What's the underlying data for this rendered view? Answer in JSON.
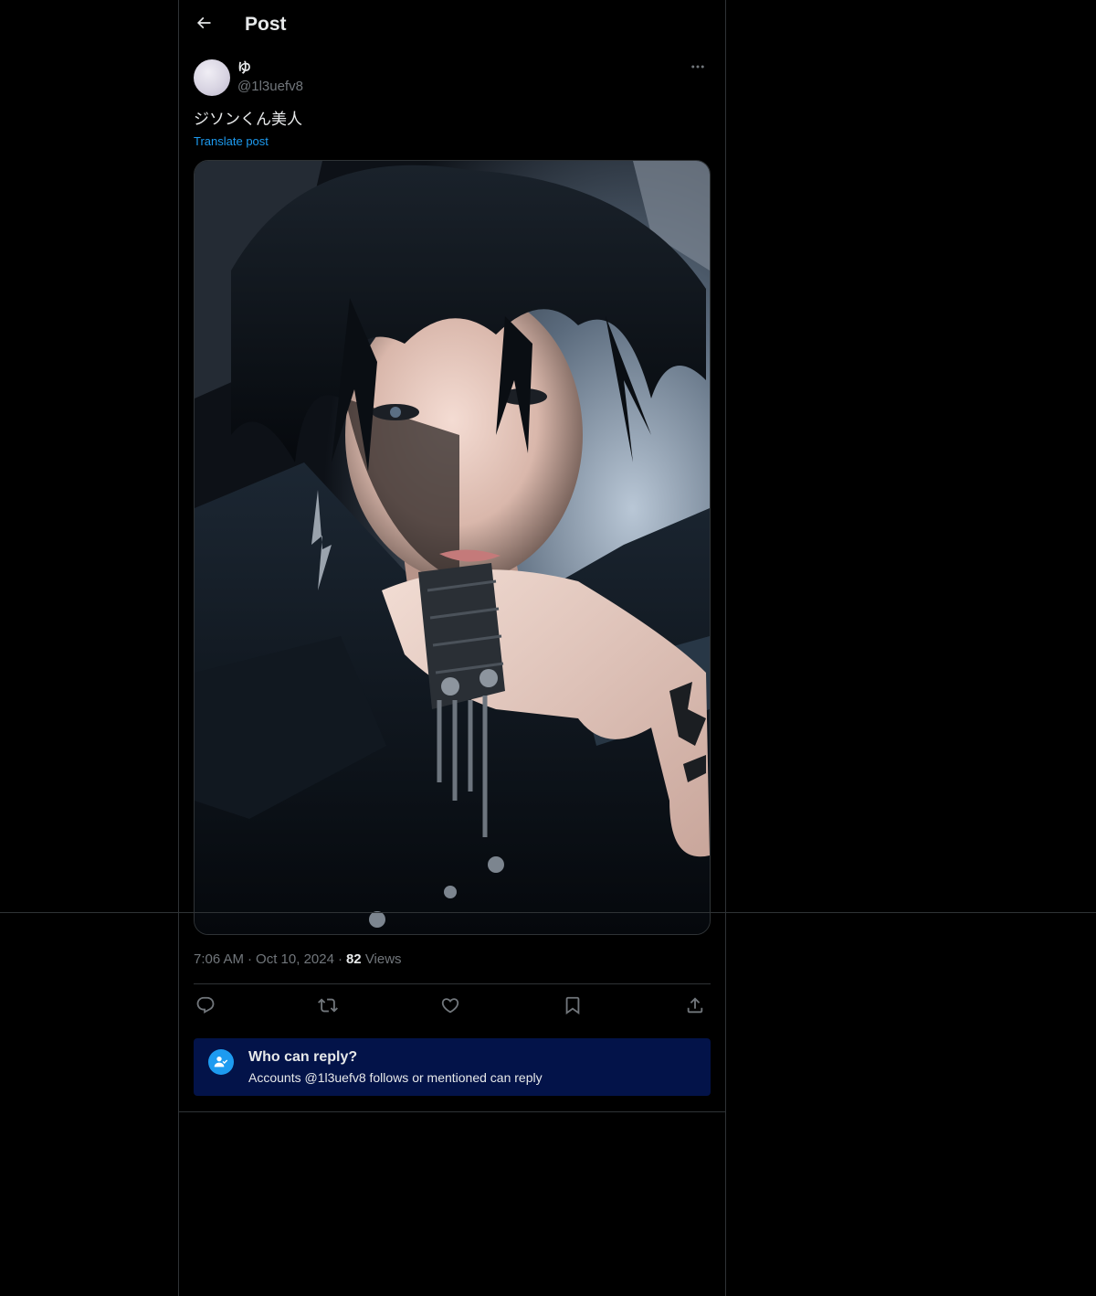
{
  "header": {
    "title": "Post",
    "back_icon": "arrow-left-icon"
  },
  "post": {
    "author": {
      "display_name": "ゆ",
      "handle": "@1l3uefv8"
    },
    "text": "ジソンくん美人",
    "translate_label": "Translate post",
    "media": {
      "type": "photo"
    },
    "meta": {
      "time": "7:06 AM",
      "date": "Oct 10, 2024",
      "separator": "·",
      "views_count": "82",
      "views_label": "Views"
    },
    "actions": [
      {
        "name": "reply",
        "icon": "reply-icon"
      },
      {
        "name": "repost",
        "icon": "repost-icon"
      },
      {
        "name": "like",
        "icon": "heart-icon"
      },
      {
        "name": "bookmark",
        "icon": "bookmark-icon"
      },
      {
        "name": "share",
        "icon": "share-icon"
      }
    ]
  },
  "reply_restriction": {
    "title": "Who can reply?",
    "description": "Accounts @1l3uefv8 follows or mentioned can reply",
    "icon": "person-check-icon"
  },
  "colors": {
    "background": "#000000",
    "text_primary": "#e7e9ea",
    "text_secondary": "#71767b",
    "accent": "#1d9bf0",
    "border": "#2f3336",
    "reply_card_bg": "#031349"
  }
}
